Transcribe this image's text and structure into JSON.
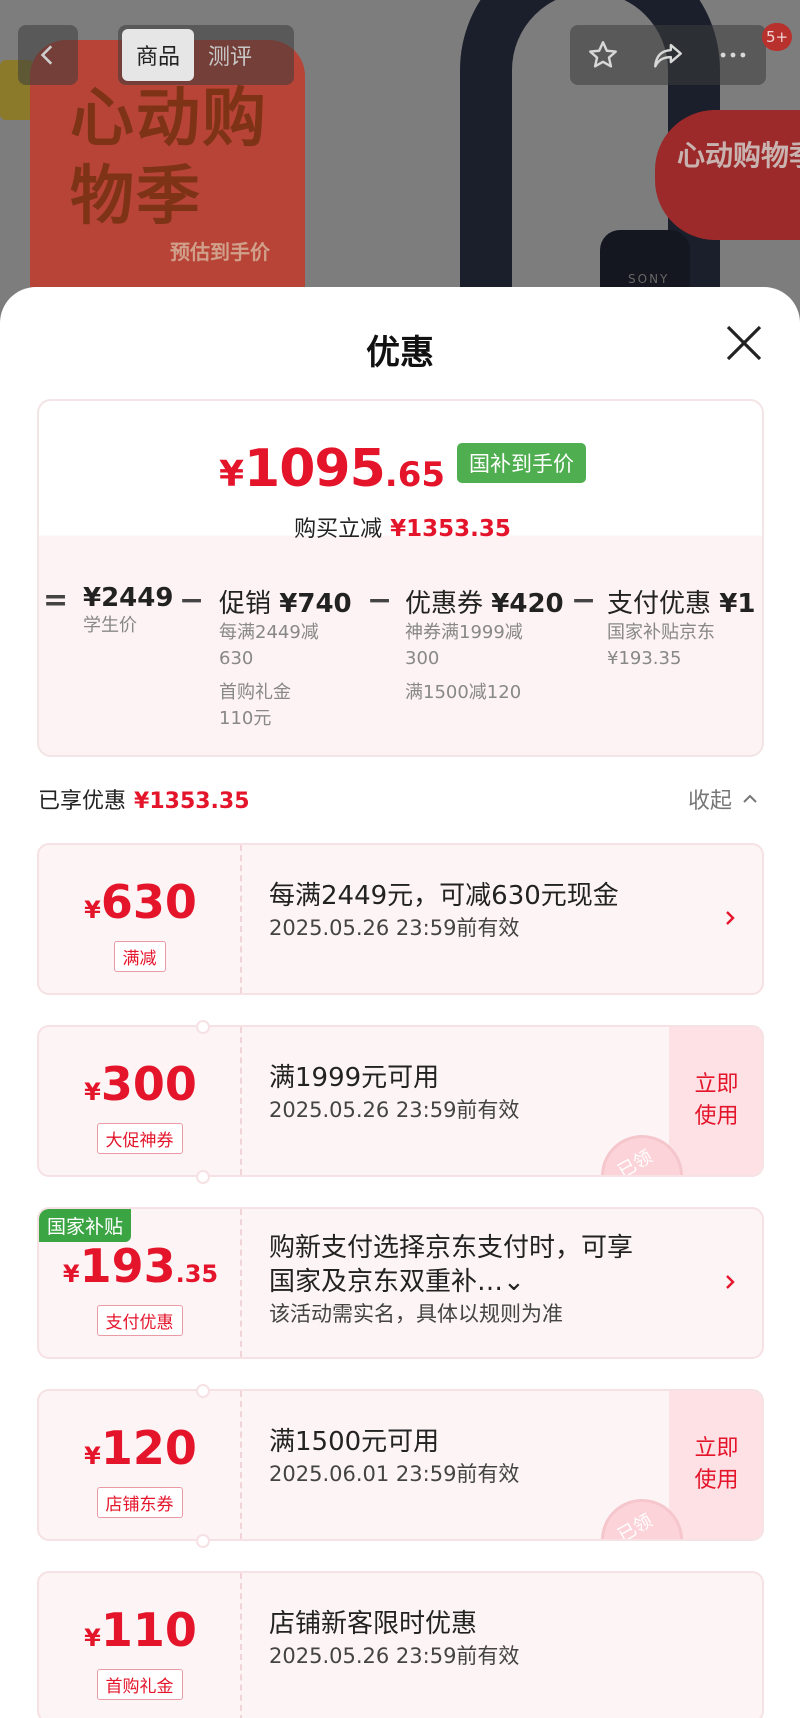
{
  "background": {
    "promo_text": "心动购物季",
    "promo_sub": "预估到手价",
    "badge_right": "心动购物季",
    "brand_small": "SONY"
  },
  "header": {
    "tabs": [
      {
        "label": "商品",
        "active": true
      },
      {
        "label": "测评",
        "active": false
      }
    ],
    "notification_count": "5+",
    "icons": [
      "back-arrow-icon",
      "star-icon",
      "share-icon",
      "more-icon"
    ]
  },
  "sheet": {
    "title": "优惠",
    "summary": {
      "currency": "¥",
      "price_int": "1095",
      "price_dec": ".65",
      "price_tag": "国补到手价",
      "reduce_label": "购买立减",
      "reduce_value": "¥1353.35",
      "calc": [
        {
          "op": "=",
          "head_label": "",
          "head_value": "¥2449",
          "details": [
            "学生价"
          ]
        },
        {
          "op": "−",
          "head_label": "促销",
          "head_value": "¥740",
          "details": [
            "每满2449减",
            "630"
          ],
          "extra": [
            "首购礼金",
            "110元"
          ]
        },
        {
          "op": "−",
          "head_label": "优惠券",
          "head_value": "¥420",
          "details": [
            "神券满1999减",
            "300"
          ],
          "extra": [
            "满1500减120"
          ]
        },
        {
          "op": "−",
          "head_label": "支付优惠",
          "head_value": "¥1",
          "details": [
            "国家补贴京东",
            "¥193.35"
          ]
        }
      ]
    },
    "enjoyed_label": "已享优惠",
    "enjoyed_value": "¥1353.35",
    "collapse_label": "收起",
    "coupons": [
      {
        "cur": "¥",
        "amount": "630",
        "dec": "",
        "tag": "满减",
        "line1": "每满2449元，可减630元现金",
        "line2": "2025.05.26 23:59前有效",
        "action": "arrow"
      },
      {
        "cur": "¥",
        "amount": "300",
        "dec": "",
        "tag": "大促神券",
        "line1": "满1999元可用",
        "line2": "2025.05.26 23:59前有效",
        "action": "use",
        "use_label": "立即使用",
        "stamp": "已领"
      },
      {
        "cur": "¥",
        "amount": "193",
        "dec": ".35",
        "tag": "支付优惠",
        "corner": "国家补贴",
        "line1": "购新支付选择京东支付时，可享",
        "line1b": "国家及京东双重补…⌄",
        "line2": "该活动需实名，具体以规则为准",
        "action": "arrow"
      },
      {
        "cur": "¥",
        "amount": "120",
        "dec": "",
        "tag": "店铺东券",
        "line1": "满1500元可用",
        "line2": "2025.06.01 23:59前有效",
        "action": "use",
        "use_label": "立即使用",
        "stamp": "已领"
      },
      {
        "cur": "¥",
        "amount": "110",
        "dec": "",
        "tag": "首购礼金",
        "line1": "店铺新客限时优惠",
        "line2": "2025.05.26 23:59前有效",
        "action": "none"
      }
    ]
  },
  "colors": {
    "accent_red": "#e4152b",
    "subsidy_green": "#4fae50",
    "coupon_bg": "#fdf4f5"
  }
}
